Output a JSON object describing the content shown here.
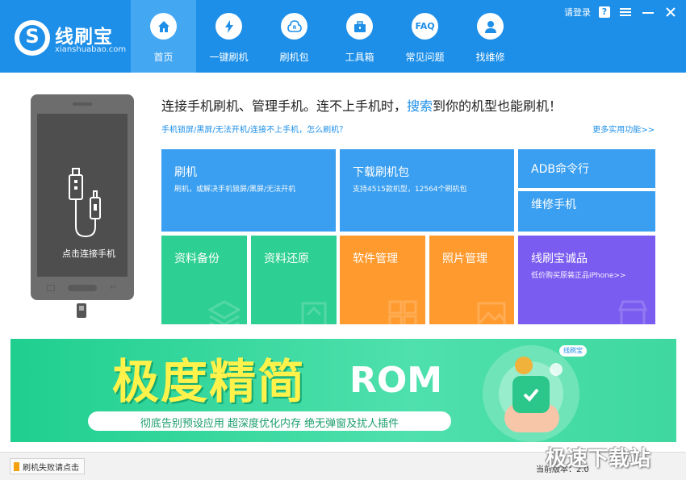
{
  "app": {
    "name": "线刷宝",
    "domain": "xianshuabao.com"
  },
  "window": {
    "login_label": "请登录",
    "help_label": "?",
    "menu_icon": "hamburger-icon",
    "minimize_icon": "minimize-icon",
    "close_icon": "close-icon"
  },
  "nav": {
    "items": [
      {
        "label": "首页",
        "icon": "home-icon",
        "active": true
      },
      {
        "label": "一键刷机",
        "icon": "lightning-icon",
        "active": false
      },
      {
        "label": "刷机包",
        "icon": "rom-package-icon",
        "active": false
      },
      {
        "label": "工具箱",
        "icon": "toolbox-icon",
        "active": false
      },
      {
        "label": "常见问题",
        "icon": "faq-icon",
        "icon_text": "FAQ",
        "active": false
      },
      {
        "label": "找维修",
        "icon": "repair-person-icon",
        "active": false
      }
    ]
  },
  "phone": {
    "label": "点击连接手机"
  },
  "headline": {
    "before": "连接手机刷机、管理手机。连不上手机时，",
    "link": "搜索",
    "after": "到你的机型也能刷机！",
    "sublink": "手机锁屏/黑屏/无法开机/连接不上手机，怎么刷机？",
    "more_link": "更多实用功能>>"
  },
  "tiles": {
    "flash": {
      "title": "刷机",
      "desc": "刷机，或解决手机锁屏/黑屏/无法开机"
    },
    "download": {
      "title": "下载刷机包",
      "desc": "支持4515款机型，12564个刷机包"
    },
    "adb": {
      "title": "ADB命令行"
    },
    "repair": {
      "title": "维修手机"
    },
    "backup": {
      "title": "资料备份"
    },
    "restore": {
      "title": "资料还原"
    },
    "apps": {
      "title": "软件管理"
    },
    "photos": {
      "title": "照片管理"
    },
    "shop": {
      "title": "线刷宝诚品",
      "desc": "低价购买原装正品iPhone>>"
    }
  },
  "colors": {
    "header": "#1d8fe8",
    "tile_blue": "#3a9ff0",
    "tile_green": "#2ecf92",
    "tile_orange": "#ff9a2e",
    "tile_purple": "#7a5cf0"
  },
  "banner": {
    "big_text": "极度精简",
    "rom_text": "ROM",
    "features": "彻底告别预设应用   超深度优化内存   绝无弹窗及扰人插件",
    "brand_tag": "线刷宝"
  },
  "status": {
    "fail_button": "刷机失败请点击",
    "version_prefix": "当前版本：",
    "version_value": "2.0"
  },
  "watermark": "极速下载站"
}
